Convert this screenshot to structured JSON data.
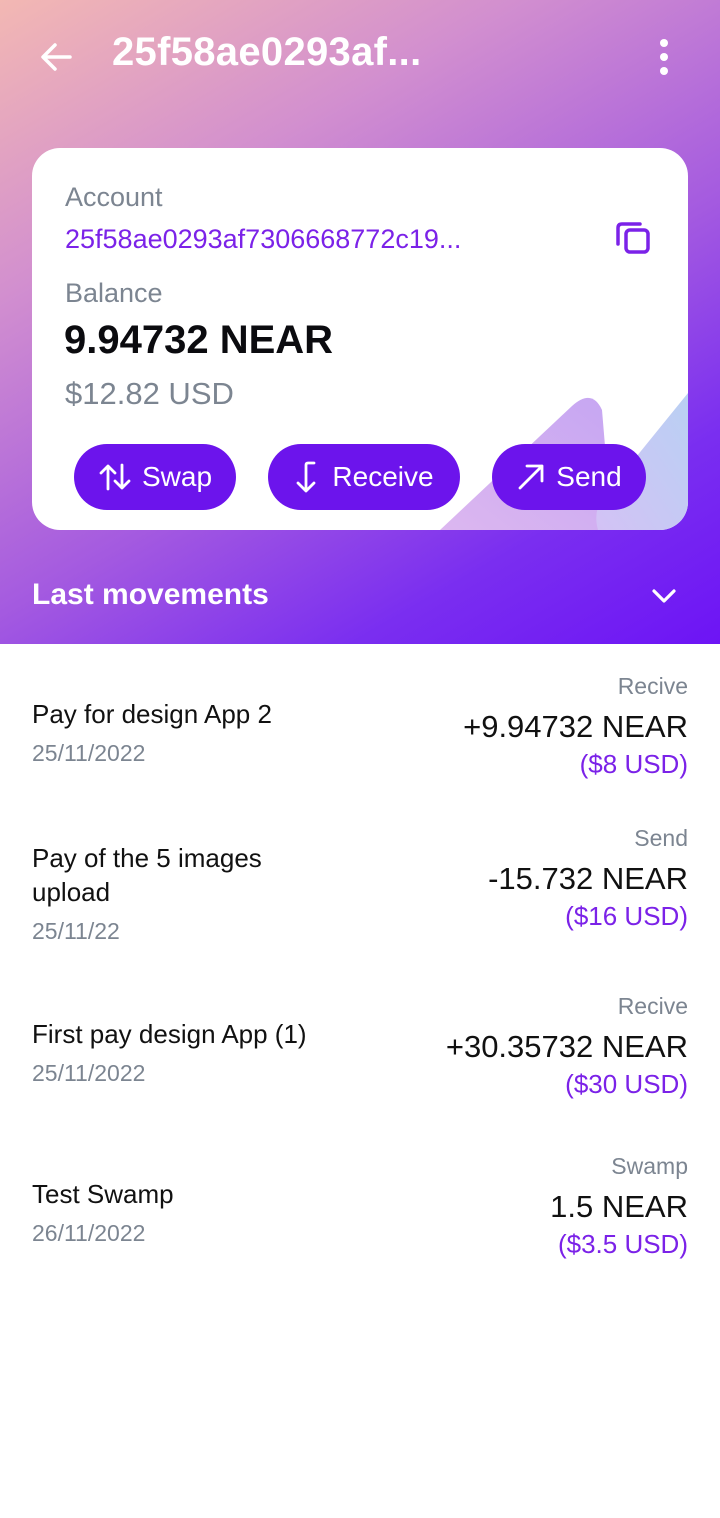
{
  "header": {
    "title": "25f58ae0293af...",
    "back_icon": "arrow-left-icon",
    "menu_icon": "more-vertical-icon"
  },
  "account_card": {
    "account_label": "Account",
    "account_id": "25f58ae0293af7306668772c19...",
    "copy_icon": "copy-icon",
    "balance_label": "Balance",
    "balance_amount": "9.94732 NEAR",
    "balance_usd": "$12.82 USD",
    "actions": [
      {
        "label": "Swap",
        "icon": "swap-arrows-icon"
      },
      {
        "label": "Receive",
        "icon": "receive-arrow-icon"
      },
      {
        "label": "Send",
        "icon": "send-arrow-icon"
      }
    ]
  },
  "movements_section": {
    "title": "Last movements",
    "collapse_icon": "chevron-down-icon"
  },
  "movements": [
    {
      "title": "Pay for design App 2",
      "date": "25/11/2022",
      "type": "Recive",
      "amount": "+9.94732 NEAR",
      "usd": "($8 USD)"
    },
    {
      "title": "Pay of the 5 images upload",
      "date": "25/11/22",
      "type": "Send",
      "amount": "-15.732 NEAR",
      "usd": "($16 USD)"
    },
    {
      "title": "First pay design App (1)",
      "date": "25/11/2022",
      "type": "Recive",
      "amount": "+30.35732 NEAR",
      "usd": "($30 USD)"
    },
    {
      "title": "Test Swamp",
      "date": "26/11/2022",
      "type": "Swamp",
      "amount": "1.5 NEAR",
      "usd": "($3.5 USD)"
    }
  ],
  "colors": {
    "accent": "#6c14ec",
    "link": "#7b22e8",
    "muted": "#7c8591",
    "gradient_start": "#f3b8b3",
    "gradient_end": "#6d14f5"
  }
}
